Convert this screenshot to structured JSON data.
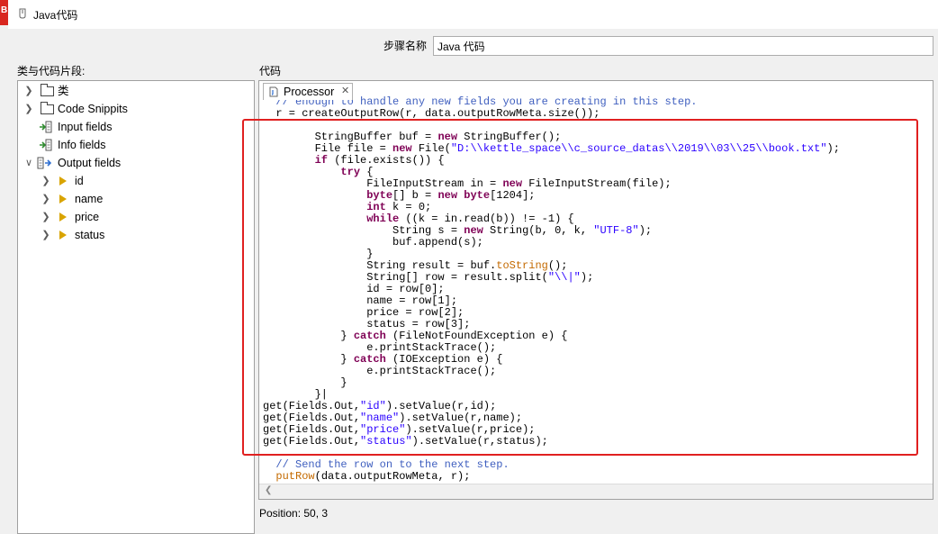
{
  "window": {
    "title": "Java代码",
    "side_badge": "B"
  },
  "step": {
    "label": "步骤名称",
    "value": "Java 代码"
  },
  "left_panel": {
    "label": "类与代码片段:"
  },
  "code_panel": {
    "label": "代码"
  },
  "tree": {
    "items": [
      {
        "label": "类"
      },
      {
        "label": "Code Snippits"
      },
      {
        "label": "Input fields"
      },
      {
        "label": "Info fields"
      },
      {
        "label": "Output fields",
        "expanded": true,
        "children": [
          {
            "label": "id"
          },
          {
            "label": "name"
          },
          {
            "label": "price"
          },
          {
            "label": "status"
          }
        ]
      }
    ]
  },
  "editor": {
    "tab_label": "Processor",
    "code_lines": [
      {
        "segments": [
          {
            "t": "  // enough to handle any new fields you are creating in this step.",
            "c": "cm"
          }
        ]
      },
      {
        "segments": [
          {
            "t": "  r = createOutputRow(r, data.outputRowMeta.size());"
          }
        ]
      },
      {
        "segments": [
          {
            "t": ""
          }
        ]
      },
      {
        "segments": [
          {
            "t": "        StringBuffer buf = "
          },
          {
            "t": "new",
            "c": "kw"
          },
          {
            "t": " StringBuffer();"
          }
        ]
      },
      {
        "segments": [
          {
            "t": "        File file = "
          },
          {
            "t": "new",
            "c": "kw"
          },
          {
            "t": " File("
          },
          {
            "t": "\"D:\\\\kettle_space\\\\c_source_datas\\\\2019\\\\03\\\\25\\\\book.txt\"",
            "c": "str"
          },
          {
            "t": ");"
          }
        ]
      },
      {
        "segments": [
          {
            "t": "        "
          },
          {
            "t": "if",
            "c": "kw"
          },
          {
            "t": " (file.exists()) {"
          }
        ]
      },
      {
        "segments": [
          {
            "t": "            "
          },
          {
            "t": "try",
            "c": "kw"
          },
          {
            "t": " {"
          }
        ]
      },
      {
        "segments": [
          {
            "t": "                FileInputStream in = "
          },
          {
            "t": "new",
            "c": "kw"
          },
          {
            "t": " FileInputStream(file);"
          }
        ]
      },
      {
        "segments": [
          {
            "t": "                "
          },
          {
            "t": "byte",
            "c": "kw"
          },
          {
            "t": "[] b = "
          },
          {
            "t": "new",
            "c": "kw"
          },
          {
            "t": " "
          },
          {
            "t": "byte",
            "c": "kw"
          },
          {
            "t": "[1204];"
          }
        ]
      },
      {
        "segments": [
          {
            "t": "                "
          },
          {
            "t": "int",
            "c": "kw"
          },
          {
            "t": " k = 0;"
          }
        ]
      },
      {
        "segments": [
          {
            "t": "                "
          },
          {
            "t": "while",
            "c": "kw"
          },
          {
            "t": " ((k = in.read(b)) != -1) {"
          }
        ]
      },
      {
        "segments": [
          {
            "t": "                    String s = "
          },
          {
            "t": "new",
            "c": "kw"
          },
          {
            "t": " String(b, 0, k, "
          },
          {
            "t": "\"UTF-8\"",
            "c": "str"
          },
          {
            "t": ");"
          }
        ]
      },
      {
        "segments": [
          {
            "t": "                    buf.append(s);"
          }
        ]
      },
      {
        "segments": [
          {
            "t": "                }"
          }
        ]
      },
      {
        "segments": [
          {
            "t": "                String result = buf."
          },
          {
            "t": "toString",
            "c": "mth"
          },
          {
            "t": "();"
          }
        ]
      },
      {
        "segments": [
          {
            "t": "                String[] row = result.split("
          },
          {
            "t": "\"\\\\|\"",
            "c": "str"
          },
          {
            "t": ");"
          }
        ]
      },
      {
        "segments": [
          {
            "t": "                id = row[0];"
          }
        ]
      },
      {
        "segments": [
          {
            "t": "                name = row[1];"
          }
        ]
      },
      {
        "segments": [
          {
            "t": "                price = row[2];"
          }
        ]
      },
      {
        "segments": [
          {
            "t": "                status = row[3];"
          }
        ]
      },
      {
        "segments": [
          {
            "t": "            } "
          },
          {
            "t": "catch",
            "c": "kw"
          },
          {
            "t": " (FileNotFoundException e) {"
          }
        ]
      },
      {
        "segments": [
          {
            "t": "                e.printStackTrace();"
          }
        ]
      },
      {
        "segments": [
          {
            "t": "            } "
          },
          {
            "t": "catch",
            "c": "kw"
          },
          {
            "t": " (IOException e) {"
          }
        ]
      },
      {
        "segments": [
          {
            "t": "                e.printStackTrace();"
          }
        ]
      },
      {
        "segments": [
          {
            "t": "            }"
          }
        ]
      },
      {
        "segments": [
          {
            "t": "        }|"
          }
        ]
      },
      {
        "segments": [
          {
            "t": "get(Fields.Out,"
          },
          {
            "t": "\"id\"",
            "c": "str"
          },
          {
            "t": ").setValue(r,id);"
          }
        ]
      },
      {
        "segments": [
          {
            "t": "get(Fields.Out,"
          },
          {
            "t": "\"name\"",
            "c": "str"
          },
          {
            "t": ").setValue(r,name);"
          }
        ]
      },
      {
        "segments": [
          {
            "t": "get(Fields.Out,"
          },
          {
            "t": "\"price\"",
            "c": "str"
          },
          {
            "t": ").setValue(r,price);"
          }
        ]
      },
      {
        "segments": [
          {
            "t": "get(Fields.Out,"
          },
          {
            "t": "\"status\"",
            "c": "str"
          },
          {
            "t": ").setValue(r,status);"
          }
        ]
      },
      {
        "segments": [
          {
            "t": ""
          }
        ]
      },
      {
        "segments": [
          {
            "t": "  // Send the row on to the next step.",
            "c": "cm"
          }
        ]
      },
      {
        "segments": [
          {
            "t": "  "
          },
          {
            "t": "putRow",
            "c": "mth"
          },
          {
            "t": "(data.outputRowMeta, r);"
          }
        ]
      }
    ]
  },
  "status_bar": {
    "position": "Position: 50, 3"
  },
  "colors": {
    "highlight_border": "#e02020",
    "keyword": "#7f0055",
    "string": "#2a00ff",
    "comment": "#3f5fbf",
    "method": "#c46a00"
  }
}
